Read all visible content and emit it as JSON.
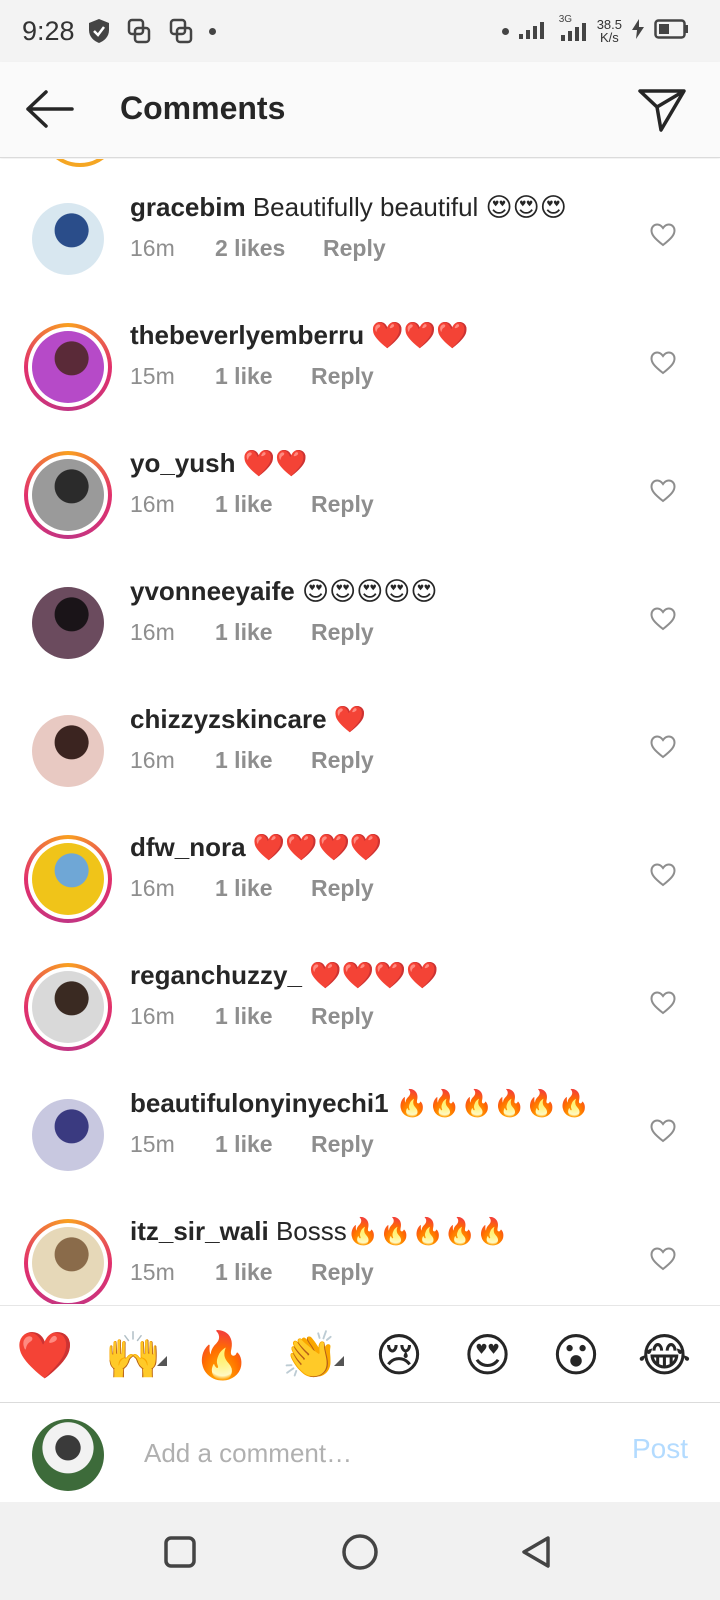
{
  "status_bar": {
    "time": "9:28",
    "net_speed_value": "38.5",
    "net_speed_unit": "K/s",
    "network_type": "3G"
  },
  "header": {
    "title": "Comments"
  },
  "comments": [
    {
      "username": "gracebim",
      "text": "Beautifully beautiful 😍😍😍",
      "time": "16m",
      "likes": "2 likes",
      "reply": "Reply",
      "story_ring": false,
      "avatar_colors": [
        "#d8e7f0",
        "#2a4d8a"
      ]
    },
    {
      "username": "thebeverlyemberru",
      "text": "❤️❤️❤️",
      "time": "15m",
      "likes": "1 like",
      "reply": "Reply",
      "story_ring": true,
      "avatar_colors": [
        "#b64ac8",
        "#5a2a38"
      ]
    },
    {
      "username": "yo_yush",
      "text": "❤️❤️",
      "time": "16m",
      "likes": "1 like",
      "reply": "Reply",
      "story_ring": true,
      "avatar_colors": [
        "#9a9a9a",
        "#2b2b2b"
      ]
    },
    {
      "username": "yvonneeyaife",
      "text": "😍😍😍😍😍",
      "time": "16m",
      "likes": "1 like",
      "reply": "Reply",
      "story_ring": false,
      "avatar_colors": [
        "#6b4b5e",
        "#1a1418"
      ]
    },
    {
      "username": "chizzyzskincare",
      "text": "❤️",
      "time": "16m",
      "likes": "1 like",
      "reply": "Reply",
      "story_ring": false,
      "avatar_colors": [
        "#e8c9c2",
        "#3b2420"
      ]
    },
    {
      "username": "dfw_nora",
      "text": "❤️❤️❤️❤️",
      "time": "16m",
      "likes": "1 like",
      "reply": "Reply",
      "story_ring": true,
      "avatar_colors": [
        "#f0c419",
        "#6fa7d6"
      ]
    },
    {
      "username": "reganchuzzy_",
      "text": "❤️❤️❤️❤️",
      "time": "16m",
      "likes": "1 like",
      "reply": "Reply",
      "story_ring": true,
      "avatar_colors": [
        "#d9d9d9",
        "#3a2a22"
      ]
    },
    {
      "username": "beautifulonyinyechi1",
      "text": "🔥🔥🔥🔥🔥🔥",
      "time": "15m",
      "likes": "1 like",
      "reply": "Reply",
      "story_ring": false,
      "avatar_colors": [
        "#c8c8e0",
        "#3a3a80"
      ]
    },
    {
      "username": "itz_sir_wali",
      "text": "Bosss🔥🔥🔥🔥🔥",
      "time": "15m",
      "likes": "1 like",
      "reply": "Reply",
      "story_ring": true,
      "avatar_colors": [
        "#e6d8b8",
        "#8a6b4a"
      ]
    }
  ],
  "reactions": [
    "❤️",
    "🙌",
    "🔥",
    "👏",
    "😢",
    "😍",
    "😮",
    "😂"
  ],
  "composer": {
    "placeholder": "Add a comment…",
    "post_label": "Post"
  },
  "icons": {
    "back": "arrow-left-icon",
    "share": "paper-plane-icon",
    "like": "heart-outline-icon"
  },
  "colors": {
    "story_ring_start": "#f9a020",
    "story_ring_end": "#c13584",
    "post_disabled": "#b3dbff",
    "meta_grey": "#8e8e8e"
  }
}
